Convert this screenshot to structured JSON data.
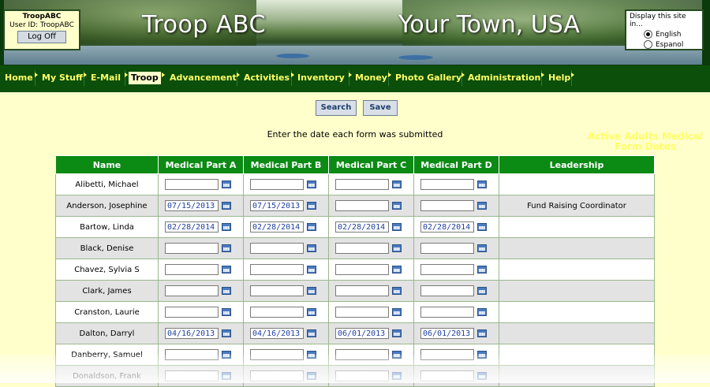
{
  "header": {
    "title_left": "Troop ABC",
    "title_right": "Your Town, USA",
    "user": {
      "troop_name": "TroopABC",
      "user_id": "User ID:  TroopABC",
      "logoff_label": "Log Off"
    },
    "language": {
      "label": "Display this site in...",
      "options": [
        "English",
        "Espanol"
      ],
      "selected": "English"
    }
  },
  "nav": {
    "items": [
      "Home",
      "My Stuff",
      "E-Mail",
      "Troop",
      "Advancement",
      "Activities",
      "Inventory",
      "Money",
      "Photo Gallery",
      "Administration",
      "Help"
    ],
    "active": "Troop",
    "page_title": "Active Adults Medical Form Dates"
  },
  "toolbar": {
    "search_label": "Search",
    "save_label": "Save"
  },
  "instruction": "Enter the date each form was submitted",
  "table": {
    "columns": [
      "Name",
      "Medical Part A",
      "Medical Part B",
      "Medical Part C",
      "Medical Part D",
      "Leadership"
    ],
    "rows": [
      {
        "name": "Alibetti, Michael",
        "a": "",
        "b": "",
        "c": "",
        "d": "",
        "leadership": ""
      },
      {
        "name": "Anderson, Josephine",
        "a": "07/15/2013",
        "b": "07/15/2013",
        "c": "",
        "d": "",
        "leadership": "Fund Raising Coordinator"
      },
      {
        "name": "Bartow, Linda",
        "a": "02/28/2014",
        "b": "02/28/2014",
        "c": "02/28/2014",
        "d": "02/28/2014",
        "leadership": ""
      },
      {
        "name": "Black, Denise",
        "a": "",
        "b": "",
        "c": "",
        "d": "",
        "leadership": ""
      },
      {
        "name": "Chavez, Sylvia S",
        "a": "",
        "b": "",
        "c": "",
        "d": "",
        "leadership": ""
      },
      {
        "name": "Clark, James",
        "a": "",
        "b": "",
        "c": "",
        "d": "",
        "leadership": ""
      },
      {
        "name": "Cranston, Laurie",
        "a": "",
        "b": "",
        "c": "",
        "d": "",
        "leadership": ""
      },
      {
        "name": "Dalton, Darryl",
        "a": "04/16/2013",
        "b": "04/16/2013",
        "c": "06/01/2013",
        "d": "06/01/2013",
        "leadership": ""
      },
      {
        "name": "Danberry, Samuel",
        "a": "",
        "b": "",
        "c": "",
        "d": "",
        "leadership": ""
      },
      {
        "name": "Donaldson, Frank",
        "a": "",
        "b": "",
        "c": "",
        "d": "",
        "leadership": ""
      }
    ]
  },
  "colors": {
    "nav_bg": "#0b4f0b",
    "nav_text": "#ffff66",
    "header_green": "#0b8a14",
    "page_bg": "#ffffcc"
  },
  "icons": {
    "calendar": "calendar-icon",
    "radio": "radio-icon"
  }
}
